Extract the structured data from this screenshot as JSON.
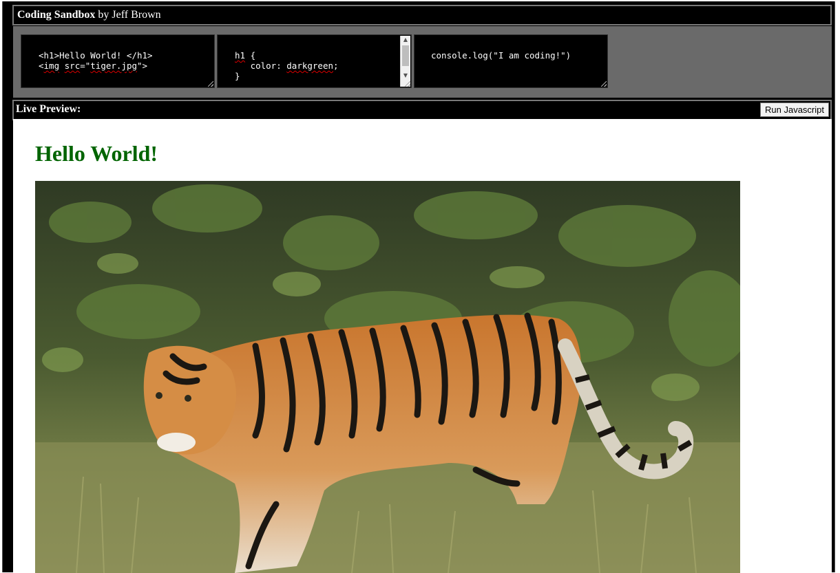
{
  "title": {
    "app_name": "Coding Sandbox",
    "byline": " by Jeff Brown"
  },
  "editors": {
    "html_lines": [
      "<h1>Hello World! </h1>",
      "<img src=\"tiger.jpg\">"
    ],
    "css_lines": [
      "h1 {",
      "   color: darkgreen;",
      "}"
    ],
    "js_lines": [
      "console.log(\"I am coding!\")"
    ]
  },
  "preview_bar": {
    "label": "Live Preview:",
    "run_button": "Run Javascript"
  },
  "preview": {
    "heading": "Hello World!",
    "heading_color": "#006400",
    "image_subject": "tiger"
  },
  "colors": {
    "chrome_bg": "#000000",
    "editor_panel_bg": "#6a6a6a",
    "border": "#7a7a7a"
  }
}
